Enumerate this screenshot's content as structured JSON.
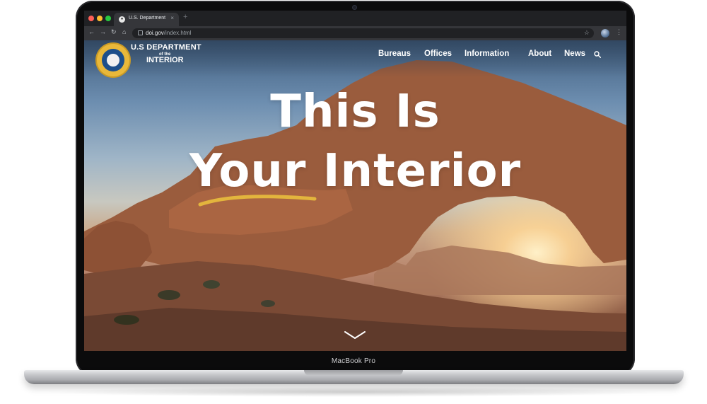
{
  "browser": {
    "tab_title": "U.S. Department",
    "url_domain": "doi.gov",
    "url_path": "/index.html",
    "new_tab_glyph": "+"
  },
  "site": {
    "logo_text": {
      "line1": "U.S DEPARTMENT",
      "line2": "of the",
      "line3": "INTERIOR"
    },
    "nav": [
      "Bureaus",
      "Offices",
      "Information",
      "About",
      "News"
    ],
    "hero": {
      "line1": "This Is",
      "line2": "Your Interior"
    },
    "accent_color": "#e3b53d"
  },
  "device": {
    "label": "MacBook Pro"
  },
  "icons": {
    "search": "search-icon",
    "chevron": "chevron-down-icon",
    "seal": "department-seal-icon"
  }
}
